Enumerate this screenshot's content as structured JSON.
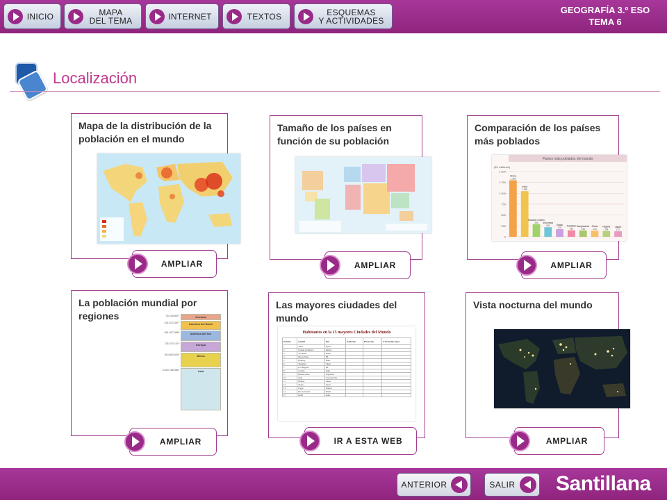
{
  "header": {
    "nav": [
      {
        "label": "INICIO"
      },
      {
        "label": "MAPA\nDEL TEMA"
      },
      {
        "label": "INTERNET"
      },
      {
        "label": "TEXTOS"
      },
      {
        "label": "ESQUEMAS\nY ACTIVIDADES"
      }
    ],
    "course_line1": "GEOGRAFÍA 3.º ESO",
    "course_line2": "TEMA 6"
  },
  "page": {
    "title": "Localización"
  },
  "cards": [
    {
      "title": "Mapa de la distribución de la población en el mundo",
      "action": "AMPLIAR"
    },
    {
      "title": "Tamaño de los países en función de su población",
      "action": "AMPLIAR"
    },
    {
      "title": "Comparación de los países más poblados",
      "action": "AMPLIAR"
    },
    {
      "title": "La población mundial por regiones",
      "action": "AMPLIAR"
    },
    {
      "title": "Las mayores ciudades del mundo",
      "action": "IR A ESTA WEB"
    },
    {
      "title": "Vista nocturna del mundo",
      "action": "AMPLIAR"
    }
  ],
  "thumbs": {
    "countries_chart": {
      "title": "Países más poblados del mundo",
      "unit": "(En millones)",
      "yticks": [
        "1.500",
        "1.250",
        "1.000",
        "750",
        "500",
        "250",
        "0"
      ],
      "bars": [
        {
          "label": "China",
          "value": "1.300"
        },
        {
          "label": "India",
          "value": "1.050"
        },
        {
          "label": "Estados Unidos",
          "value": "290"
        },
        {
          "label": "Indonesia",
          "value": "220"
        },
        {
          "label": "Brasil",
          "value": "176"
        },
        {
          "label": "Pakistán",
          "value": "150"
        },
        {
          "label": "Bangladesh",
          "value": "146"
        },
        {
          "label": "Rusia",
          "value": "144"
        },
        {
          "label": "Nigeria",
          "value": "134"
        },
        {
          "label": "Japón",
          "value": "127"
        }
      ]
    },
    "regions_chart": {
      "rows": [
        {
          "name": "Oceanía",
          "value": "33.108.867*"
        },
        {
          "name": "América del Norte",
          "value": "331.672.387*"
        },
        {
          "name": "América del Sur",
          "value": "561.827.988*"
        },
        {
          "name": "Europa",
          "value": "726.270.100*"
        },
        {
          "name": "África",
          "value": "910.890.629*"
        },
        {
          "name": "Asia",
          "value": "3.900.768.988*"
        }
      ]
    },
    "cities_table": {
      "title": "Habitantes en la 15 mayores Ciudades del Mundo",
      "headers": [
        "Posición",
        "Ciudad",
        "País",
        "Población",
        "Proyección",
        "% Promedio anual"
      ],
      "rows": [
        [
          "1",
          "Tokio",
          "Japón"
        ],
        [
          "2",
          "Ciudad de México",
          "México"
        ],
        [
          "3",
          "Sao Paulo",
          "Brasil"
        ],
        [
          "4",
          "Nueva York",
          "EE"
        ],
        [
          "5",
          "Bombay",
          "India"
        ],
        [
          "6",
          "Shanghai",
          "China"
        ],
        [
          "7",
          "Los Ángeles",
          "EE"
        ],
        [
          "8",
          "Calcuta",
          "India"
        ],
        [
          "9",
          "Buenos Aires",
          "Argentina"
        ],
        [
          "10",
          "Seúl",
          "Corea del Sur"
        ],
        [
          "11",
          "Beijing",
          "China"
        ],
        [
          "12",
          "Osaka",
          "Japón"
        ],
        [
          "13",
          "Lagos",
          "Nigeria"
        ],
        [
          "14",
          "Río de Janeiro",
          "Brasil"
        ],
        [
          "15",
          "Delhi",
          "India"
        ]
      ]
    }
  },
  "footer": {
    "prev": "ANTERIOR",
    "exit": "SALIR",
    "publisher": "Santillana"
  }
}
